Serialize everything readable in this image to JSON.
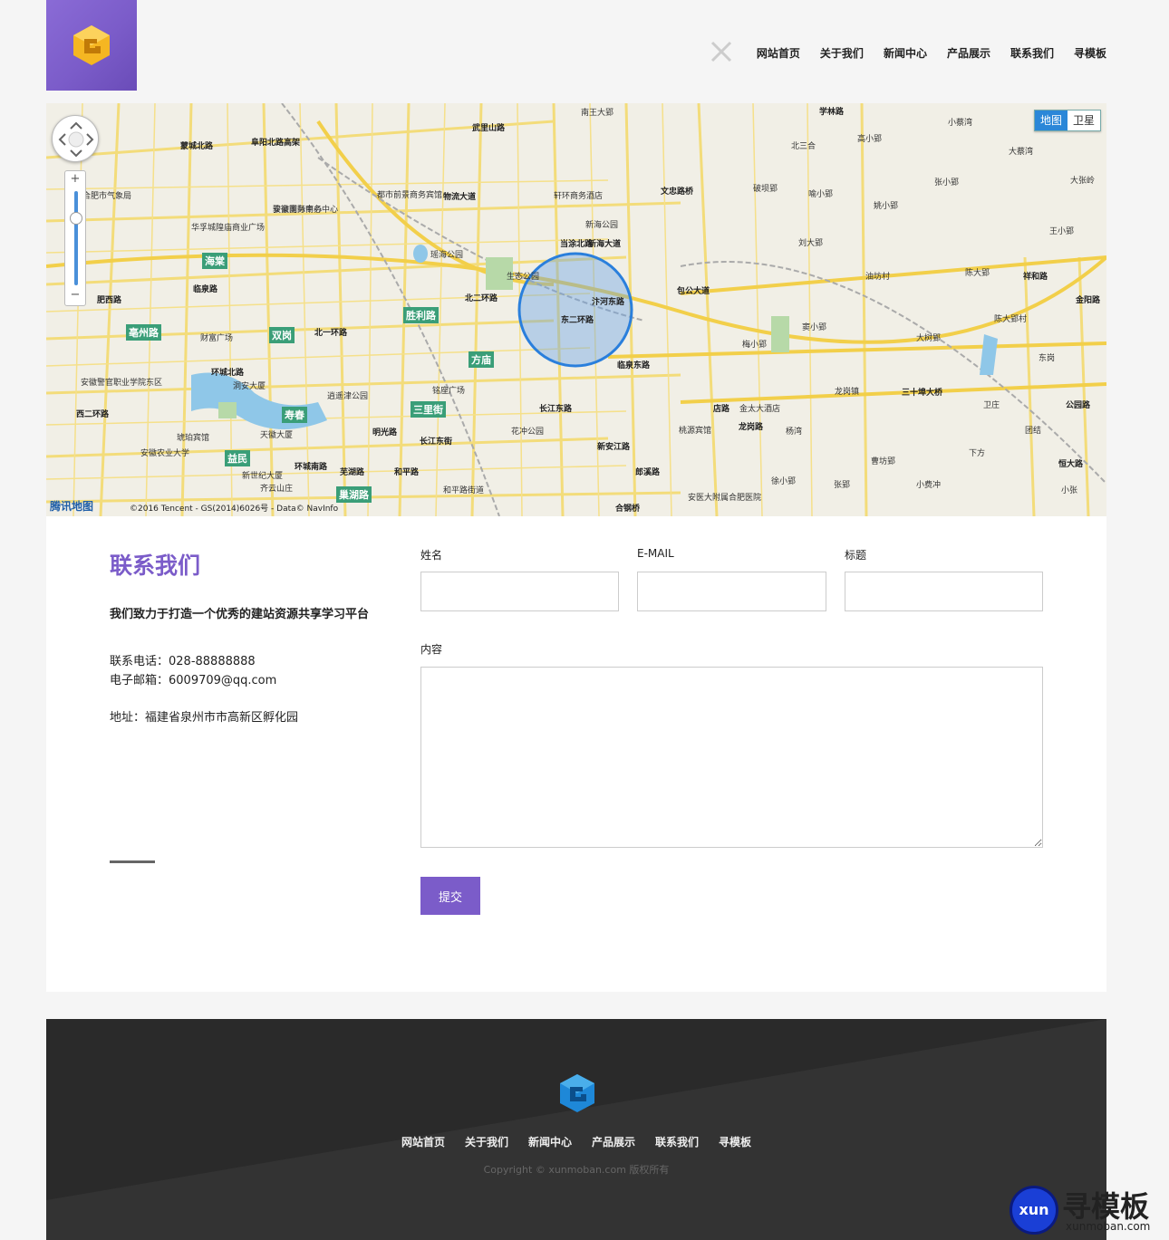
{
  "nav": {
    "items": [
      "网站首页",
      "关于我们",
      "新闻中心",
      "产品展示",
      "联系我们",
      "寻模板"
    ]
  },
  "map": {
    "toggle_map": "地图",
    "toggle_satellite": "卫星",
    "brand": "腾讯地图",
    "credit": "©2016 Tencent - GS(2014)6026号 - Data© NavInfo",
    "zoom_in": "+",
    "zoom_out": "−",
    "labels": [
      "武里山路",
      "合肥市气象局",
      "安徽国际商务中心",
      "华孚城隍庙商业广场",
      "临泉路",
      "瑶海公园",
      "生态公园",
      "新海公园",
      "轩环商务酒店",
      "文忠路桥",
      "南王大郢",
      "学林路",
      "小蔡湾",
      "北三合",
      "高小郢",
      "破坝郢",
      "喻小郢",
      "姚小郢",
      "大蔡湾",
      "张小郢",
      "大张岭",
      "王小郢",
      "刘大郢",
      "油坊村",
      "陈大郢",
      "陈大郢村",
      "梅小郢",
      "窦小郢",
      "大树郢",
      "东岗",
      "龙岗镇",
      "三十埠大桥",
      "卫庄",
      "团结",
      "下方",
      "恒大路",
      "小张",
      "曹坊郢",
      "小费冲",
      "张郢",
      "徐小郢",
      "杨湾",
      "金太大酒店",
      "桃源宾馆",
      "安医大附属合肥医院",
      "合钢桥",
      "花冲公园",
      "铭座广场",
      "逍遥津公园",
      "天徽大厦",
      "新世纪大厦",
      "齐云山庄",
      "安徽农业大学",
      "琥珀宾馆",
      "财富广场",
      "安徽警官职业学院东区",
      "洞安大厦",
      "长江东街",
      "和平路",
      "和平路街道",
      "新安江路",
      "包公大道",
      "汴河东路",
      "临泉东路",
      "长江东路",
      "北二环路",
      "北一环路",
      "环城北路",
      "环城南路",
      "西二环路",
      "肥西路",
      "蒙城北路",
      "阜阳北路高架",
      "骏豪商务中心",
      "都市前景商务宾馆",
      "物流大道",
      "新海大道",
      "当涂北路",
      "东二环路",
      "祥和路",
      "金阳路",
      "龙岗路",
      "郎溪路",
      "店路",
      "公园路",
      "明光路",
      "芜湖路"
    ],
    "tags": [
      "海棠",
      "胜利路",
      "双岗",
      "亳州路",
      "方庙",
      "三里街",
      "寿春",
      "益民",
      "巢湖路",
      "包公大道"
    ]
  },
  "contact": {
    "title": "联系我们",
    "slogan": "我们致力于打造一个优秀的建站资源共享学习平台",
    "phone": "联系电话：028-88888888",
    "email": "电子邮箱：6009709@qq.com",
    "address": "地址：福建省泉州市市高新区孵化园",
    "form": {
      "name_label": "姓名",
      "email_label": "E-MAIL",
      "subject_label": "标题",
      "content_label": "内容",
      "submit_label": "提交"
    }
  },
  "footer": {
    "nav": [
      "网站首页",
      "关于我们",
      "新闻中心",
      "产品展示",
      "联系我们",
      "寻模板"
    ],
    "copyright": "Copyright © xunmoban.com 版权所有"
  },
  "watermark": {
    "circle": "xun",
    "name": "寻模板",
    "url": "xunmoban.com"
  },
  "colors": {
    "accent": "#7b5cc9",
    "map_active": "#2b87d8",
    "footer_bg": "#2a2a2a"
  }
}
